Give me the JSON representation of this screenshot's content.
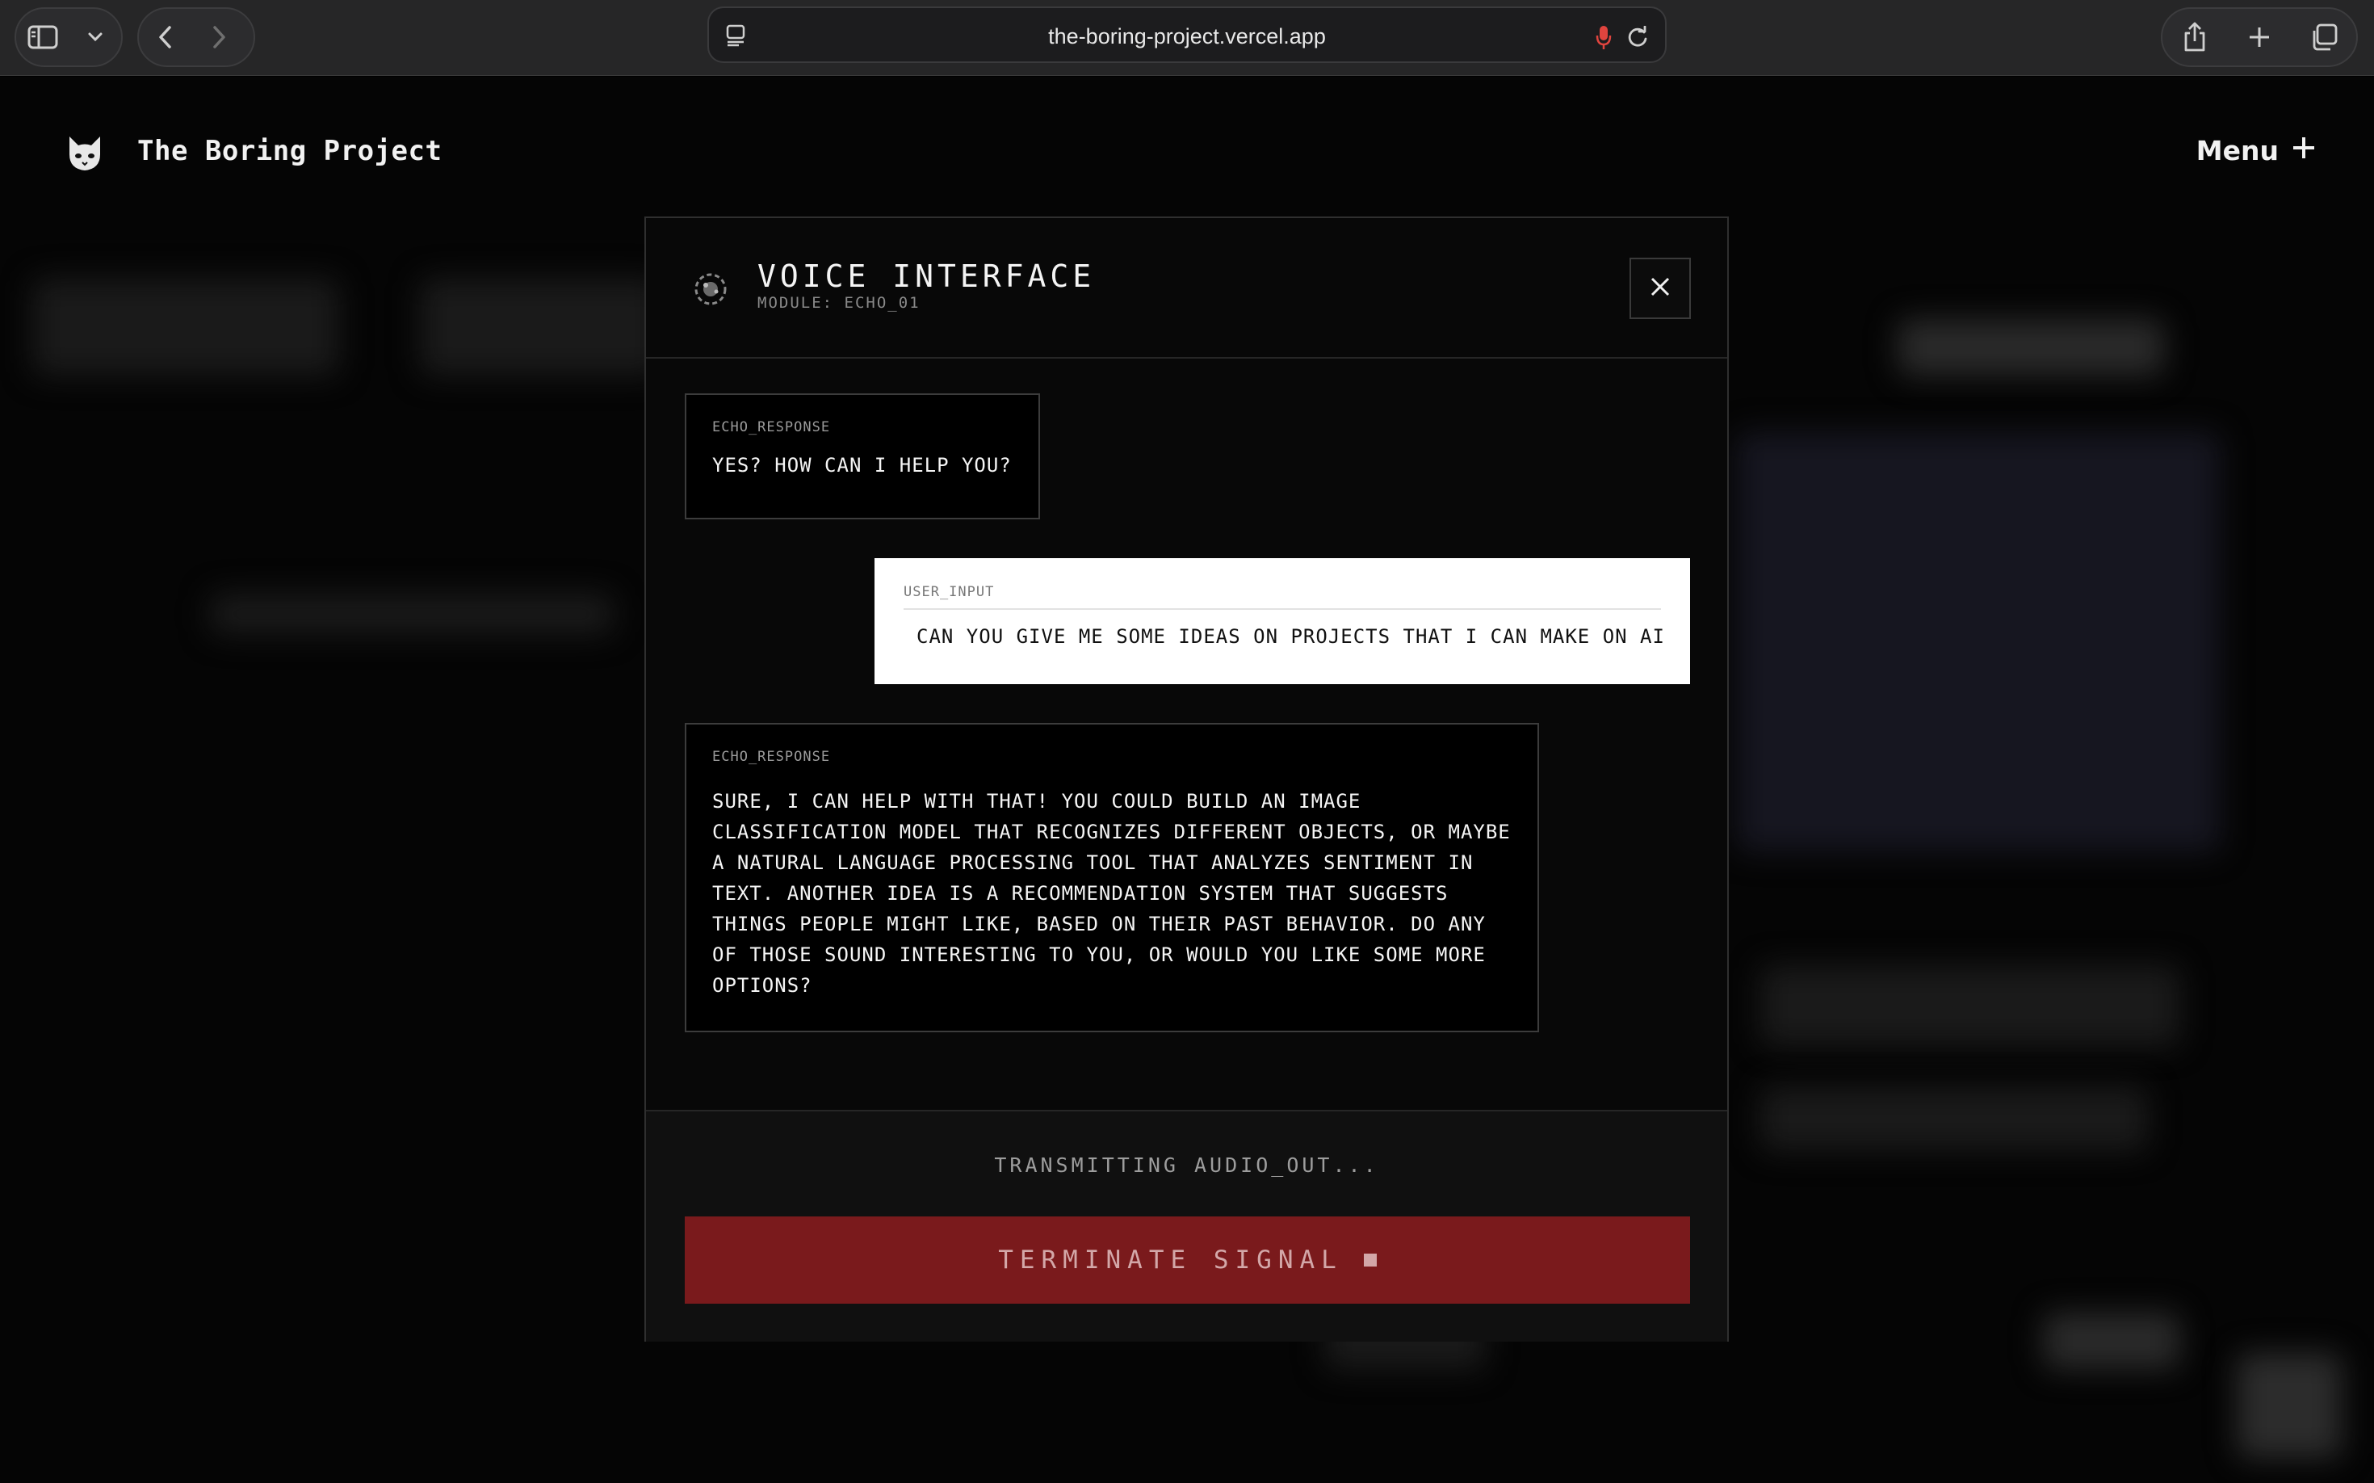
{
  "browser": {
    "url": "the-boring-project.vercel.app"
  },
  "site": {
    "brand": "The Boring Project",
    "menu_label": "Menu"
  },
  "modal": {
    "title": "VOICE INTERFACE",
    "subtitle": "MODULE: ECHO_01",
    "messages": [
      {
        "label": "ECHO_RESPONSE",
        "text": "YES? HOW CAN I HELP YOU?"
      },
      {
        "label": "USER_INPUT",
        "text": "CAN YOU GIVE ME SOME IDEAS ON PROJECTS THAT I CAN MAKE ON AI"
      },
      {
        "label": "ECHO_RESPONSE",
        "text": "SURE, I CAN HELP WITH THAT! YOU COULD BUILD AN IMAGE CLASSIFICATION MODEL THAT RECOGNIZES DIFFERENT OBJECTS, OR MAYBE A NATURAL LANGUAGE PROCESSING TOOL THAT ANALYZES SENTIMENT IN TEXT. ANOTHER IDEA IS A RECOMMENDATION SYSTEM THAT SUGGESTS THINGS PEOPLE MIGHT LIKE, BASED ON THEIR PAST BEHAVIOR. DO ANY OF THOSE SOUND INTERESTING TO YOU, OR WOULD YOU LIKE SOME MORE OPTIONS?"
      }
    ],
    "status": "TRANSMITTING AUDIO_OUT...",
    "terminate_label": "TERMINATE SIGNAL"
  },
  "colors": {
    "terminate_bg": "#7a1a1c",
    "mic_icon": "#e0443e",
    "user_bubble_bg": "#ffffff"
  },
  "icons": [
    "sidebar-icon",
    "chevron-down-icon",
    "back-icon",
    "forward-icon",
    "page-icon",
    "microphone-icon",
    "reload-icon",
    "share-icon",
    "plus-icon",
    "tabs-icon",
    "cat-logo-icon",
    "plus-icon",
    "radar-icon",
    "close-icon",
    "stop-icon"
  ]
}
